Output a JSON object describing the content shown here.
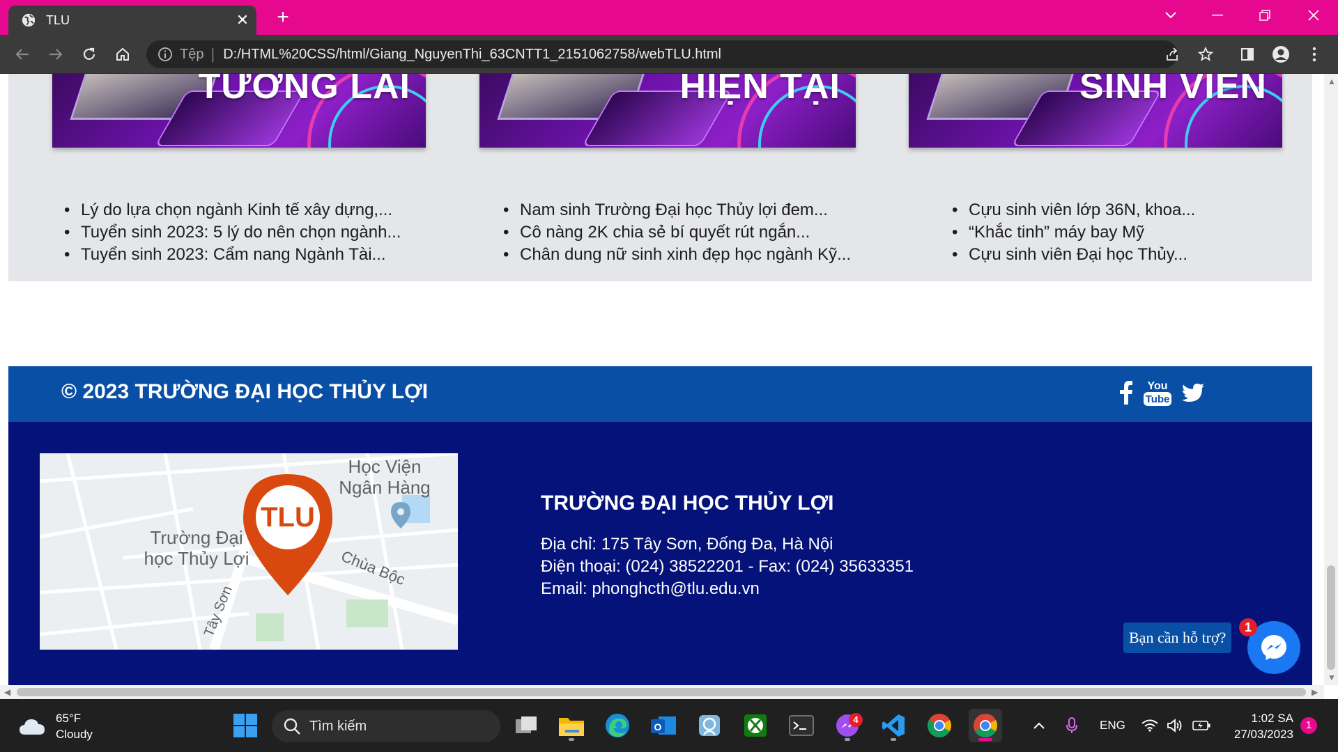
{
  "browser": {
    "tab_title": "TLU",
    "tab_close": "✕",
    "new_tab": "+",
    "omnibox_scheme": "Tệp",
    "omnibox_separator": "|",
    "url": "D:/HTML%20CSS/html/Giang_NguyenThi_63CNTT1_2151062758/webTLU.html"
  },
  "banners": [
    {
      "text": "TƯƠNG LAI"
    },
    {
      "text": "HIỆN TẠI"
    },
    {
      "text": "SINH VIÊN"
    }
  ],
  "news_columns": [
    {
      "items": [
        "Lý do lựa chọn ngành Kinh tế xây dựng,...",
        "Tuyển sinh 2023: 5 lý do nên chọn ngành...",
        "Tuyển sinh 2023: Cẩm nang Ngành Tài..."
      ]
    },
    {
      "items": [
        "Nam sinh Trường Đại học Thủy lợi đem...",
        "Cô nàng 2K chia sẻ bí quyết rút ngắn...",
        "Chân dung nữ sinh xinh đẹp học ngành Kỹ..."
      ]
    },
    {
      "items": [
        "Cựu sinh viên lớp 36N, khoa...",
        "“Khắc tinh” máy bay Mỹ",
        "Cựu sinh viên Đại học Thủy..."
      ]
    }
  ],
  "footer": {
    "copyright": "© 2023 TRƯỜNG ĐẠI HỌC THỦY LỢI",
    "school_name": "TRƯỜNG ĐẠI HỌC THỦY LỢI",
    "address": "Địa chỉ: 175 Tây Sơn, Đống Đa, Hà Nội",
    "phone": "Điện thoại: (024) 38522201 - Fax: (024) 35633351",
    "email": "Email: phonghcth@tlu.edu.vn",
    "social": [
      "facebook-icon",
      "youtube-icon",
      "twitter-icon"
    ]
  },
  "map": {
    "logo": "TLU",
    "label_bank": "Học Viện Ngân Hàng",
    "label_school": "Trường Đại học Thủy Lợi",
    "label_street1": "Chùa Bộc",
    "label_street2": "Tây Sơn"
  },
  "chat": {
    "help_text": "Bạn cần hỗ trợ?",
    "badge": "1"
  },
  "taskbar": {
    "temp": "65°F",
    "weather": "Cloudy",
    "search_placeholder": "Tìm kiếm",
    "messenger_badge": "4",
    "language": "ENG",
    "time": "1:02 SA",
    "date": "27/03/2023",
    "notification_count": "1"
  },
  "colors": {
    "tabbar_accent": "#e6088e",
    "footer_top": "#0a4fa6",
    "footer_main": "#04127a",
    "news_bg": "#e4e6e9"
  }
}
